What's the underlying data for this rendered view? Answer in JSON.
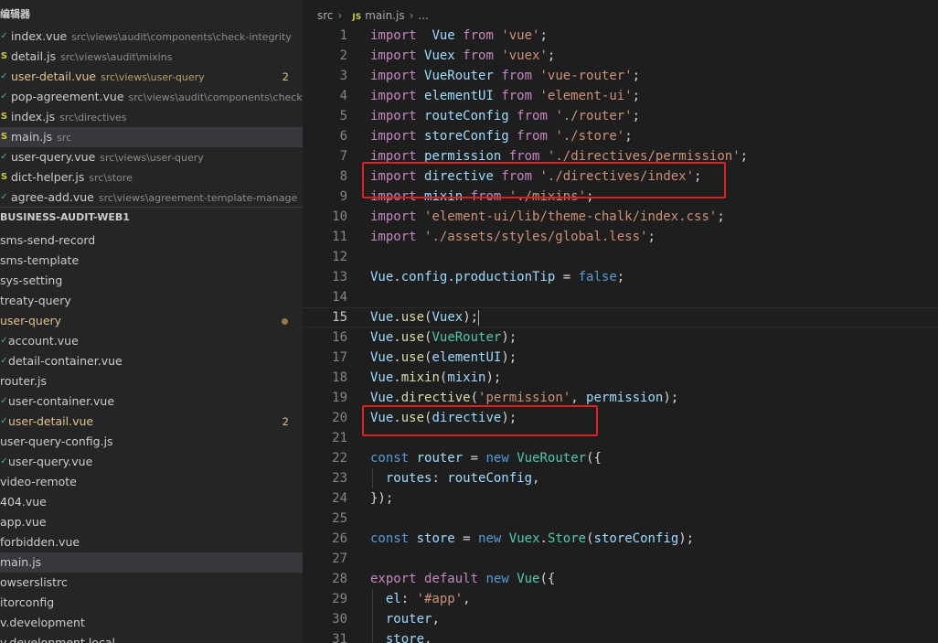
{
  "sidebar": {
    "open_editors_title": "编辑器",
    "open_editors": [
      {
        "name": "index.vue",
        "path": "src\\views\\audit\\components\\check-integrity",
        "type": "vue",
        "modified": false,
        "badge": ""
      },
      {
        "name": "detail.js",
        "path": "src\\views\\audit\\mixins",
        "type": "js",
        "modified": false,
        "badge": ""
      },
      {
        "name": "user-detail.vue",
        "path": "src\\views\\user-query",
        "type": "vue",
        "modified": true,
        "badge": "2"
      },
      {
        "name": "pop-agreement.vue",
        "path": "src\\views\\audit\\components\\check-i...",
        "type": "vue",
        "modified": false,
        "badge": ""
      },
      {
        "name": "index.js",
        "path": "src\\directives",
        "type": "js",
        "modified": false,
        "badge": ""
      },
      {
        "name": "main.js",
        "path": "src",
        "type": "js",
        "modified": false,
        "badge": "",
        "selected": true
      },
      {
        "name": "user-query.vue",
        "path": "src\\views\\user-query",
        "type": "vue",
        "modified": false,
        "badge": ""
      },
      {
        "name": "dict-helper.js",
        "path": "src\\store",
        "type": "js",
        "modified": false,
        "badge": ""
      },
      {
        "name": "agree-add.vue",
        "path": "src\\views\\agreement-template-manage",
        "type": "vue",
        "modified": false,
        "badge": ""
      }
    ],
    "project_title": "BUSINESS-AUDIT-WEB1",
    "tree": [
      {
        "name": "sms-send-record",
        "icon": "",
        "modified": false
      },
      {
        "name": "sms-template",
        "icon": "",
        "modified": false
      },
      {
        "name": "sys-setting",
        "icon": "",
        "modified": false
      },
      {
        "name": "treaty-query",
        "icon": "",
        "modified": false
      },
      {
        "name": "user-query",
        "icon": "",
        "modified": true,
        "dot": true
      },
      {
        "name": "account.vue",
        "icon": "vue",
        "modified": false
      },
      {
        "name": "detail-container.vue",
        "icon": "vue",
        "modified": false
      },
      {
        "name": "router.js",
        "icon": "",
        "modified": false
      },
      {
        "name": "user-container.vue",
        "icon": "vue",
        "modified": false
      },
      {
        "name": "user-detail.vue",
        "icon": "vue",
        "modified": true,
        "badge": "2"
      },
      {
        "name": "user-query-config.js",
        "icon": "",
        "modified": false
      },
      {
        "name": "user-query.vue",
        "icon": "vue",
        "modified": false
      },
      {
        "name": "video-remote",
        "icon": "",
        "modified": false
      },
      {
        "name": "404.vue",
        "icon": "",
        "modified": false
      },
      {
        "name": "app.vue",
        "icon": "",
        "modified": false
      },
      {
        "name": "forbidden.vue",
        "icon": "",
        "modified": false
      },
      {
        "name": "main.js",
        "icon": "",
        "modified": false,
        "selected": true
      },
      {
        "name": "owserslistrc",
        "icon": "",
        "modified": false
      },
      {
        "name": "itorconfig",
        "icon": "",
        "modified": false
      },
      {
        "name": "v.development",
        "icon": "",
        "modified": false
      },
      {
        "name": "v.development.local",
        "icon": "",
        "modified": false
      }
    ]
  },
  "editor": {
    "breadcrumb": {
      "folder": "src",
      "file_icon": "JS",
      "file": "main.js",
      "more": "..."
    },
    "current_line": 15,
    "lines": [
      [
        [
          "kw",
          "import"
        ],
        [
          "",
          "  "
        ],
        [
          "id",
          "Vue"
        ],
        [
          "",
          " "
        ],
        [
          "kw",
          "from"
        ],
        [
          "",
          " "
        ],
        [
          "str",
          "'vue'"
        ],
        [
          "",
          ";"
        ]
      ],
      [
        [
          "kw",
          "import"
        ],
        [
          "",
          " "
        ],
        [
          "id",
          "Vuex"
        ],
        [
          "",
          " "
        ],
        [
          "kw",
          "from"
        ],
        [
          "",
          " "
        ],
        [
          "str",
          "'vuex'"
        ],
        [
          "",
          ";"
        ]
      ],
      [
        [
          "kw",
          "import"
        ],
        [
          "",
          " "
        ],
        [
          "id",
          "VueRouter"
        ],
        [
          "",
          " "
        ],
        [
          "kw",
          "from"
        ],
        [
          "",
          " "
        ],
        [
          "str",
          "'vue-router'"
        ],
        [
          "",
          ";"
        ]
      ],
      [
        [
          "kw",
          "import"
        ],
        [
          "",
          " "
        ],
        [
          "id",
          "elementUI"
        ],
        [
          "",
          " "
        ],
        [
          "kw",
          "from"
        ],
        [
          "",
          " "
        ],
        [
          "str",
          "'element-ui'"
        ],
        [
          "",
          ";"
        ]
      ],
      [
        [
          "kw",
          "import"
        ],
        [
          "",
          " "
        ],
        [
          "id",
          "routeConfig"
        ],
        [
          "",
          " "
        ],
        [
          "kw",
          "from"
        ],
        [
          "",
          " "
        ],
        [
          "str",
          "'./router'"
        ],
        [
          "",
          ";"
        ]
      ],
      [
        [
          "kw",
          "import"
        ],
        [
          "",
          " "
        ],
        [
          "id",
          "storeConfig"
        ],
        [
          "",
          " "
        ],
        [
          "kw",
          "from"
        ],
        [
          "",
          " "
        ],
        [
          "str",
          "'./store'"
        ],
        [
          "",
          ";"
        ]
      ],
      [
        [
          "kw",
          "import"
        ],
        [
          "",
          " "
        ],
        [
          "id",
          "permission"
        ],
        [
          "",
          " "
        ],
        [
          "kw",
          "from"
        ],
        [
          "",
          " "
        ],
        [
          "str",
          "'./directives/permission'"
        ],
        [
          "",
          ";"
        ]
      ],
      [
        [
          "kw",
          "import"
        ],
        [
          "",
          " "
        ],
        [
          "id",
          "directive"
        ],
        [
          "",
          " "
        ],
        [
          "kw",
          "from"
        ],
        [
          "",
          " "
        ],
        [
          "str",
          "'./directives/index'"
        ],
        [
          "",
          ";"
        ]
      ],
      [
        [
          "kw",
          "import"
        ],
        [
          "",
          " "
        ],
        [
          "id",
          "mixin"
        ],
        [
          "",
          " "
        ],
        [
          "kw",
          "from"
        ],
        [
          "",
          " "
        ],
        [
          "str",
          "'./mixins'"
        ],
        [
          "",
          ";"
        ]
      ],
      [
        [
          "kw",
          "import"
        ],
        [
          "",
          " "
        ],
        [
          "str",
          "'element-ui/lib/theme-chalk/index.css'"
        ],
        [
          "",
          ";"
        ]
      ],
      [
        [
          "kw",
          "import"
        ],
        [
          "",
          " "
        ],
        [
          "str",
          "'./assets/styles/global.less'"
        ],
        [
          "",
          ";"
        ]
      ],
      [],
      [
        [
          "id",
          "Vue"
        ],
        [
          "",
          "."
        ],
        [
          "id",
          "config"
        ],
        [
          "",
          "."
        ],
        [
          "id",
          "productionTip"
        ],
        [
          "",
          " = "
        ],
        [
          "kw2",
          "false"
        ],
        [
          "",
          ";"
        ]
      ],
      [],
      [
        [
          "id",
          "Vue"
        ],
        [
          "",
          "."
        ],
        [
          "fn",
          "use"
        ],
        [
          "",
          "("
        ],
        [
          "id",
          "Vuex"
        ],
        [
          "",
          ");"
        ]
      ],
      [
        [
          "id",
          "Vue"
        ],
        [
          "",
          "."
        ],
        [
          "fn",
          "use"
        ],
        [
          "",
          "("
        ],
        [
          "cls",
          "VueRouter"
        ],
        [
          "",
          ");"
        ]
      ],
      [
        [
          "id",
          "Vue"
        ],
        [
          "",
          "."
        ],
        [
          "fn",
          "use"
        ],
        [
          "",
          "("
        ],
        [
          "id",
          "elementUI"
        ],
        [
          "",
          ");"
        ]
      ],
      [
        [
          "id",
          "Vue"
        ],
        [
          "",
          "."
        ],
        [
          "fn",
          "mixin"
        ],
        [
          "",
          "("
        ],
        [
          "id",
          "mixin"
        ],
        [
          "",
          ");"
        ]
      ],
      [
        [
          "id",
          "Vue"
        ],
        [
          "",
          "."
        ],
        [
          "fn",
          "directive"
        ],
        [
          "",
          "("
        ],
        [
          "str",
          "'permission'"
        ],
        [
          "",
          ", "
        ],
        [
          "id",
          "permission"
        ],
        [
          "",
          ");"
        ]
      ],
      [
        [
          "id",
          "Vue"
        ],
        [
          "",
          "."
        ],
        [
          "fn",
          "use"
        ],
        [
          "",
          "("
        ],
        [
          "id",
          "directive"
        ],
        [
          "",
          ");"
        ]
      ],
      [],
      [
        [
          "kw2",
          "const"
        ],
        [
          "",
          " "
        ],
        [
          "id",
          "router"
        ],
        [
          "",
          " = "
        ],
        [
          "kw2",
          "new"
        ],
        [
          "",
          " "
        ],
        [
          "cls",
          "VueRouter"
        ],
        [
          "",
          "({"
        ]
      ],
      [
        [
          "",
          "  "
        ],
        [
          "id",
          "routes"
        ],
        [
          "",
          ": "
        ],
        [
          "id",
          "routeConfig"
        ],
        [
          "",
          ","
        ]
      ],
      [
        [
          "",
          "});"
        ]
      ],
      [],
      [
        [
          "kw2",
          "const"
        ],
        [
          "",
          " "
        ],
        [
          "id",
          "store"
        ],
        [
          "",
          " = "
        ],
        [
          "kw2",
          "new"
        ],
        [
          "",
          " "
        ],
        [
          "cls",
          "Vuex"
        ],
        [
          "",
          "."
        ],
        [
          "cls",
          "Store"
        ],
        [
          "",
          "("
        ],
        [
          "id",
          "storeConfig"
        ],
        [
          "",
          ");"
        ]
      ],
      [],
      [
        [
          "kw",
          "export"
        ],
        [
          "",
          " "
        ],
        [
          "kw",
          "default"
        ],
        [
          "",
          " "
        ],
        [
          "kw2",
          "new"
        ],
        [
          "",
          " "
        ],
        [
          "cls",
          "Vue"
        ],
        [
          "",
          "({"
        ]
      ],
      [
        [
          "",
          "  "
        ],
        [
          "id",
          "el"
        ],
        [
          "",
          ": "
        ],
        [
          "str",
          "'#app'"
        ],
        [
          "",
          ","
        ]
      ],
      [
        [
          "",
          "  "
        ],
        [
          "id",
          "router"
        ],
        [
          "",
          ","
        ]
      ],
      [
        [
          "",
          "  "
        ],
        [
          "id",
          "store"
        ],
        [
          "",
          ","
        ]
      ]
    ],
    "highlight_color": "#e0201e"
  }
}
